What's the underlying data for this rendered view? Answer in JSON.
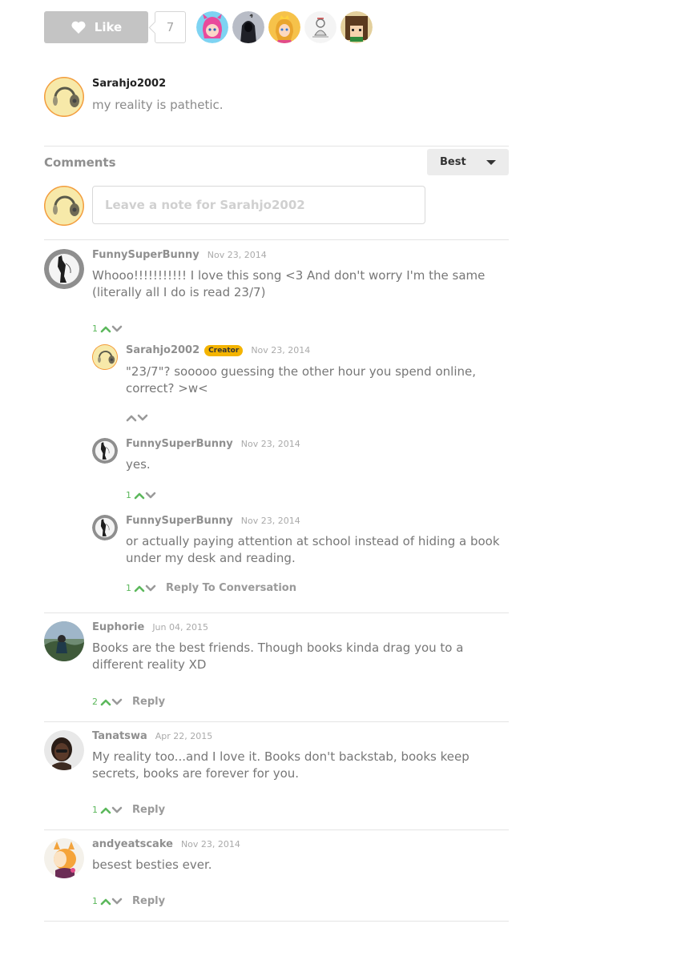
{
  "like": {
    "label": "Like",
    "count": "7",
    "likers": [
      "pink-hair-avatar",
      "hooded-figure-avatar",
      "princess-avatar",
      "sketch-avatar",
      "pixel-face-avatar"
    ]
  },
  "author": {
    "name": "Sarahjo2002",
    "status": "my reality is pathetic."
  },
  "comments_header": {
    "title": "Comments",
    "sort_selected": "Best"
  },
  "note_input": {
    "placeholder": "Leave a note for Sarahjo2002"
  },
  "comments": [
    {
      "user": "FunnySuperBunny",
      "date": "Nov 23, 2014",
      "text": "Whooo!!!!!!!!!!! I love this song <3 And don't worry I'm the same (literally all I do is read 23/7)",
      "votes": "1",
      "replies": [
        {
          "user": "Sarahjo2002",
          "badge": "Creator",
          "date": "Nov 23, 2014",
          "text": "\"23/7\"? sooooo guessing the other hour you spend online, correct? >w<",
          "votes": ""
        },
        {
          "user": "FunnySuperBunny",
          "date": "Nov 23, 2014",
          "text": "yes.",
          "votes": "1"
        },
        {
          "user": "FunnySuperBunny",
          "date": "Nov 23, 2014",
          "text": "or actually paying attention at school instead of hiding a book under my desk and reading.",
          "votes": "1",
          "action": "Reply To Conversation"
        }
      ]
    },
    {
      "user": "Euphorie",
      "date": "Jun 04, 2015",
      "text": "Books are the best friends. Though books kinda drag you to a different reality XD",
      "votes": "2",
      "action": "Reply"
    },
    {
      "user": "Tanatswa",
      "date": "Apr 22, 2015",
      "text": "My reality too...and I love it. Books don't backstab, books keep secrets, books are forever for you.",
      "votes": "1",
      "action": "Reply"
    },
    {
      "user": "andyeatscake",
      "date": "Nov 23, 2014",
      "text": "besest besties ever.",
      "votes": "1",
      "action": "Reply"
    }
  ],
  "colors": {
    "vote_green": "#5cb85c",
    "creator_badge": "#f4b400",
    "like_button": "#c4c4c4"
  }
}
